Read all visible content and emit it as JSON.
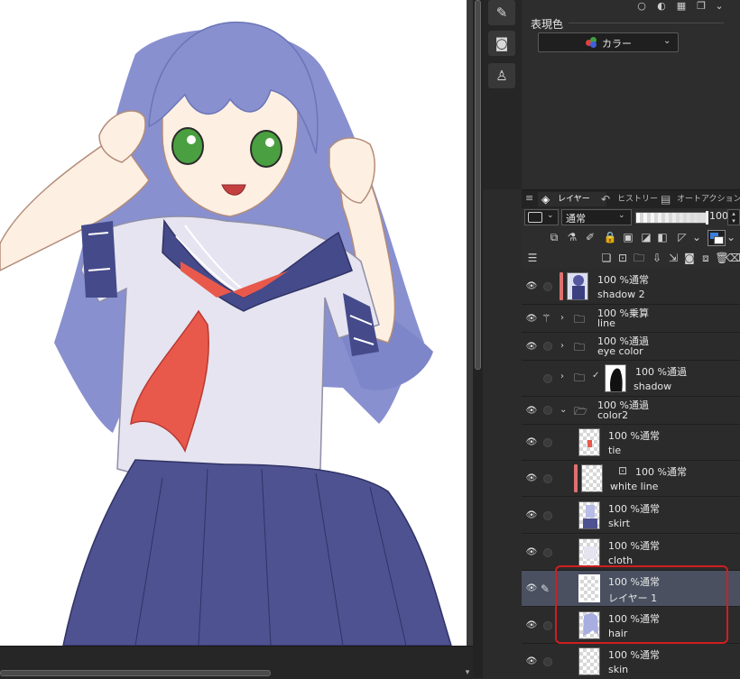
{
  "properties": {
    "expression_color_label": "表現色",
    "expression_color_value": "カラー"
  },
  "layer_tabs": [
    {
      "label": "レイヤー"
    },
    {
      "label": "ヒストリー"
    },
    {
      "label": "オートアクション"
    }
  ],
  "layer_toolbar": {
    "blend_mode": "通常",
    "opacity": "100",
    "opacity_fraction": 1.0
  },
  "layers": [
    {
      "top": "100 %通常",
      "name": "shadow 2"
    },
    {
      "top": "100 %乗算",
      "name": "line"
    },
    {
      "top": "100 %通過",
      "name": "eye color"
    },
    {
      "top": "100 %通過",
      "name": "shadow"
    },
    {
      "top": "100 %通過",
      "name": "color2"
    },
    {
      "top": "100 %通常",
      "name": "tie"
    },
    {
      "top": "100 %通常",
      "name": "white line"
    },
    {
      "top": "100 %通常",
      "name": "skirt"
    },
    {
      "top": "100 %通常",
      "name": "cloth"
    },
    {
      "top": "100 %通常",
      "name": "レイヤー 1"
    },
    {
      "top": "100 %通常",
      "name": "hair"
    },
    {
      "top": "100 %通常",
      "name": "skin"
    }
  ],
  "colors": {
    "selection_outline": "#d01e1e",
    "clip_indicator": "#e07070",
    "selected_row": "#4a5060",
    "main_color": "#3a7ee0"
  },
  "icons": [
    "canvas-icon",
    "camera-icon",
    "figure-icon",
    "layers-icon",
    "eye-icon",
    "folder-icon",
    "pen-icon",
    "lock-icon",
    "trash-icon"
  ]
}
